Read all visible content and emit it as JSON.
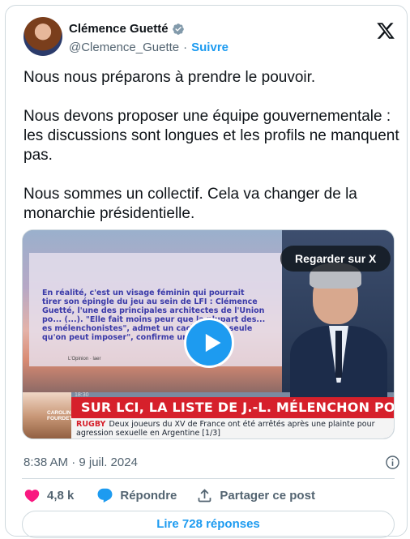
{
  "author": {
    "name": "Clémence Guetté",
    "handle": "@Clemence_Guette",
    "separator": "·",
    "follow_label": "Suivre",
    "verified_icon": "verified-badge-icon"
  },
  "tweet": {
    "paragraphs": [
      "Nous nous préparons à prendre le pouvoir.",
      "Nous devons proposer une équipe gouvernementale : les discussions sont longues et les profils ne manquent pas.",
      "Nous sommes un collectif. Cela va changer de la monarchie présidentielle."
    ]
  },
  "media": {
    "watch_label": "Regarder sur X",
    "quote_text": "En réalité, c'est un visage féminin qui pourrait tirer son épingle du jeu au sein de LFI : Clémence Guetté, l'une des principales architectes de l'Union po... (...). \"Elle fait moins peur que la plupart des... es mélenchonistes\", admet un cacique d... seule qu'on peut imposer\", confirme un co...",
    "quote_source": "L'Opinion · laer",
    "banner_headline": "SUR LCI, LA LISTE DE J.-L. MÉLENCHON POUR MATIGNON",
    "ticker_tag": "RUGBY",
    "ticker_text": "Deux joueurs du XV de France ont été arrêtés après une plainte pour agression sexuelle en Argentine [1/3]",
    "inset_name": "CAROLINE FOURDET",
    "inset_time": "18:30"
  },
  "meta": {
    "timestamp": "8:38 AM · 9 juil. 2024"
  },
  "actions": {
    "like_count": "4,8 k",
    "reply_label": "Répondre",
    "share_label": "Partager ce post"
  },
  "read_replies_label": "Lire 728 réponses",
  "colors": {
    "accent": "#1d9bf0",
    "like": "#f91880",
    "text": "#0f1419",
    "muted": "#536471",
    "border": "#cfd9de",
    "banner_red": "#d6202b"
  }
}
